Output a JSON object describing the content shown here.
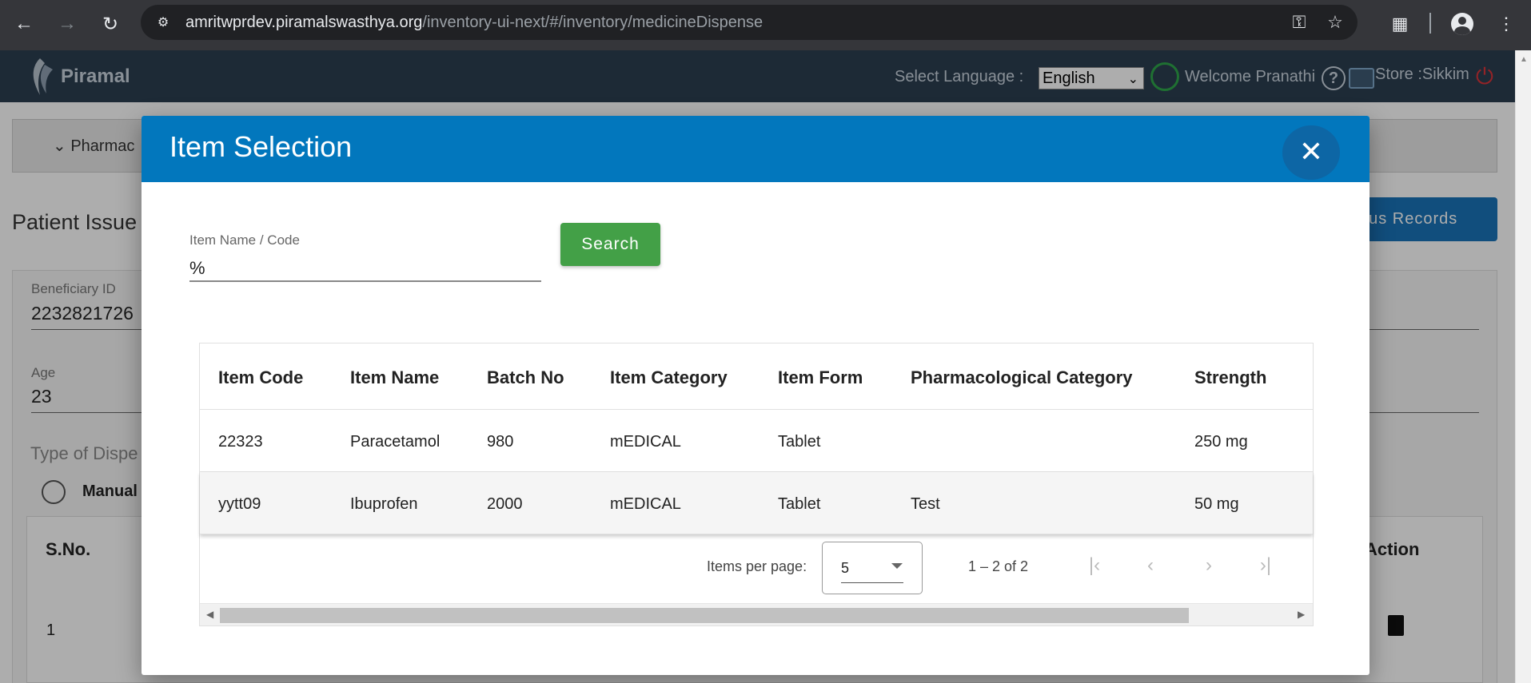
{
  "browser": {
    "url_host": "amritwprdev.piramalswasthya.org",
    "url_path": "/inventory-ui-next/#/inventory/medicineDispense"
  },
  "app_header": {
    "brand": "Piramal",
    "select_language_label": "Select Language :",
    "language_value": "English",
    "welcome_text": "Welcome Pranathi",
    "store_text": "Store :Sikkim"
  },
  "background_page": {
    "tab_label": "Pharmac",
    "page_title": "Patient Issue",
    "previous_records_button": "ous Records",
    "beneficiary_id_label": "Beneficiary ID",
    "beneficiary_id_value": "2232821726",
    "age_label": "Age",
    "age_value": "23",
    "type_label": "Type of Dispe",
    "radio_label": "Manual",
    "table_sno_header": "S.No.",
    "table_action_header": "Action",
    "table_row_sno": "1"
  },
  "dialog": {
    "title": "Item Selection",
    "search_label": "Item Name / Code",
    "search_value": "%",
    "search_button": "Search",
    "columns": [
      "Item Code",
      "Item Name",
      "Batch No",
      "Item Category",
      "Item Form",
      "Pharmacological Category",
      "Strength"
    ],
    "rows": [
      [
        "22323",
        "Paracetamol",
        "980",
        "mEDICAL",
        "Tablet",
        "",
        "250 mg"
      ],
      [
        "yytt09",
        "Ibuprofen",
        "2000",
        "mEDICAL",
        "Tablet",
        "Test",
        "50 mg"
      ]
    ],
    "paginator": {
      "items_per_page_label": "Items per page:",
      "items_per_page_value": "5",
      "range_label": "1 – 2 of 2"
    }
  }
}
